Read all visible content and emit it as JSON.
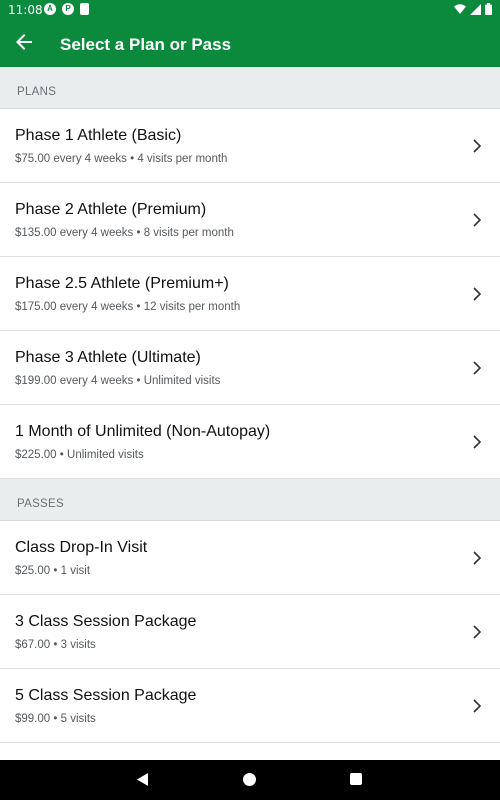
{
  "status_bar": {
    "time": "11:08",
    "icons": [
      "a-icon",
      "p-icon",
      "sd-card-icon"
    ],
    "right_icons": [
      "wifi-icon",
      "signal-icon",
      "battery-icon"
    ]
  },
  "app_bar": {
    "title": "Select a Plan or Pass",
    "back_icon": "arrow-left-icon"
  },
  "colors": {
    "primary": "#0b8a3e",
    "section_bg": "#e9edee"
  },
  "sections": [
    {
      "header": "PLANS",
      "items": [
        {
          "name": "Phase 1 Athlete (Basic)",
          "price": "$75.00 every 4 weeks",
          "detail": "4 visits per month"
        },
        {
          "name": "Phase 2 Athlete (Premium)",
          "price": "$135.00 every 4 weeks",
          "detail": "8 visits per month"
        },
        {
          "name": "Phase 2.5 Athlete (Premium+)",
          "price": "$175.00 every 4 weeks",
          "detail": "12 visits per month"
        },
        {
          "name": "Phase 3 Athlete (Ultimate)",
          "price": "$199.00 every 4 weeks",
          "detail": "Unlimited visits"
        },
        {
          "name": "1 Month of Unlimited (Non-Autopay)",
          "price": "$225.00",
          "detail": "Unlimited visits"
        }
      ]
    },
    {
      "header": "PASSES",
      "items": [
        {
          "name": "Class Drop-In Visit",
          "price": "$25.00",
          "detail": "1 visit"
        },
        {
          "name": "3 Class Session Package",
          "price": "$67.00",
          "detail": "3 visits"
        },
        {
          "name": "5 Class Session Package",
          "price": "$99.00",
          "detail": "5 visits"
        }
      ]
    }
  ],
  "separator": "•",
  "nav_bar": {
    "buttons": [
      "back-triangle-icon",
      "home-circle-icon",
      "recents-square-icon"
    ]
  }
}
